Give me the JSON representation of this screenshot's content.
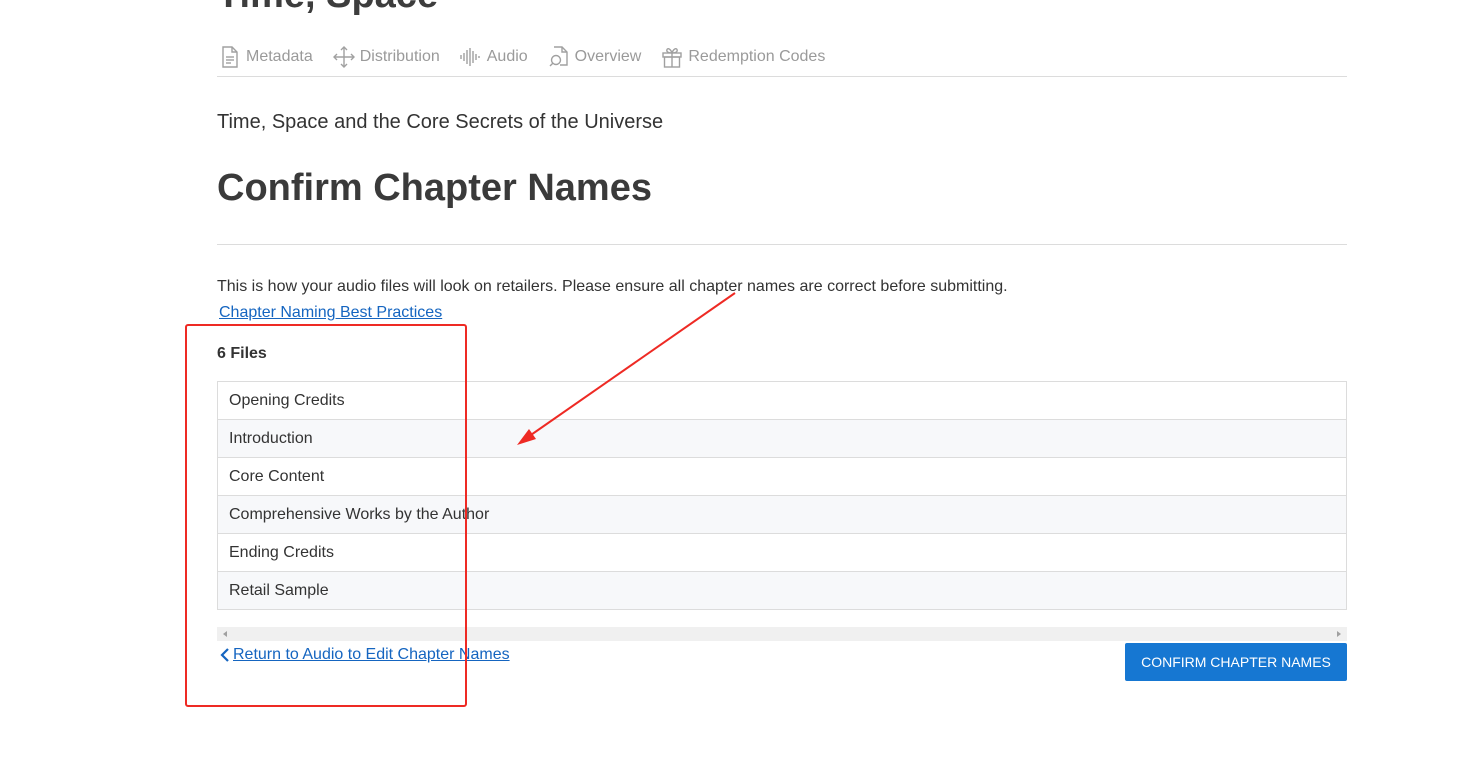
{
  "header": {
    "clipped_title": "Time, Space"
  },
  "tabs": [
    {
      "label": "Metadata",
      "icon": "document-icon"
    },
    {
      "label": "Distribution",
      "icon": "move-arrows-icon"
    },
    {
      "label": "Audio",
      "icon": "audio-waveform-icon"
    },
    {
      "label": "Overview",
      "icon": "search-document-icon"
    },
    {
      "label": "Redemption Codes",
      "icon": "gift-icon"
    }
  ],
  "main": {
    "book_title": "Time, Space and the Core Secrets of the Universe",
    "page_title": "Confirm Chapter Names",
    "description": "This is how your audio files will look on retailers. Please ensure all chapter names are correct before submitting.",
    "best_practices_link": "Chapter Naming Best Practices",
    "file_count": "6 Files",
    "files": [
      "Opening Credits",
      "Introduction",
      "Core Content",
      "Comprehensive Works by the Author",
      "Ending Credits",
      "Retail Sample"
    ],
    "return_link": "Return to Audio to Edit Chapter Names",
    "confirm_button": "CONFIRM CHAPTER NAMES"
  },
  "colors": {
    "link": "#1565c0",
    "primary_button": "#1677d2",
    "annotation": "#ee2a24",
    "tab_text": "#9a9a9a"
  }
}
